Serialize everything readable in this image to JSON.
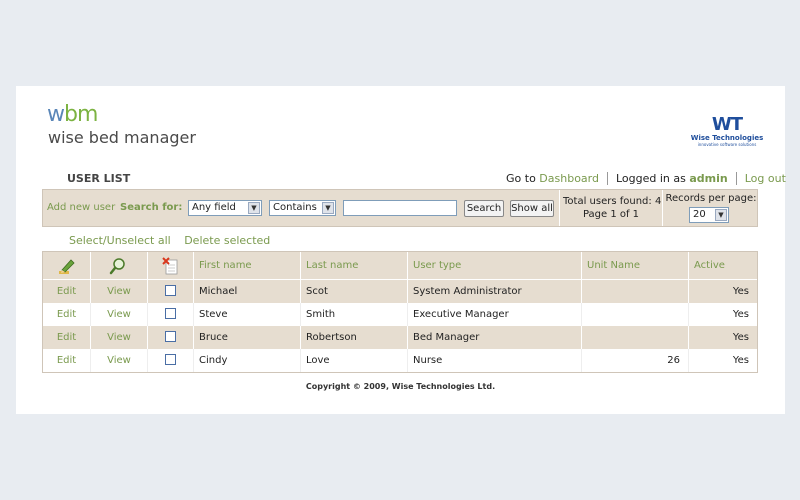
{
  "logo": {
    "mark_w": "w",
    "mark_bm": "bm",
    "name": "wise bed manager"
  },
  "partner": {
    "mark": "WT",
    "name": "Wise Technologies",
    "tagline": "innovative software solutions"
  },
  "title": "USER LIST",
  "topnav": {
    "goto_label": "Go to",
    "dashboard": "Dashboard",
    "logged_prefix": "Logged in as",
    "user": "admin",
    "logout": "Log out"
  },
  "toolbar": {
    "add_new": "Add new user",
    "search_for": "Search for:",
    "field_select": "Any field",
    "mode_select": "Contains",
    "query_value": "",
    "search_button": "Search",
    "show_all_button": "Show all",
    "total_line": "Total users found: 4",
    "page_line": "Page 1 of 1",
    "rpp_label": "Records per page:",
    "rpp_value": "20"
  },
  "actions": {
    "select_toggle": "Select/Unselect all",
    "delete_selected": "Delete selected"
  },
  "table": {
    "headers": [
      "First name",
      "Last name",
      "User type",
      "Unit Name",
      "Active"
    ],
    "edit_label": "Edit",
    "view_label": "View",
    "rows": [
      {
        "first": "Michael",
        "last": "Scot",
        "type": "System Administrator",
        "unit": "",
        "active": "Yes"
      },
      {
        "first": "Steve",
        "last": "Smith",
        "type": "Executive Manager",
        "unit": "",
        "active": "Yes"
      },
      {
        "first": "Bruce",
        "last": "Robertson",
        "type": "Bed Manager",
        "unit": "",
        "active": "Yes"
      },
      {
        "first": "Cindy",
        "last": "Love",
        "type": "Nurse",
        "unit": "26",
        "active": "Yes"
      }
    ]
  },
  "footer": "Copyright © 2009, Wise Technologies Ltd.",
  "colors": {
    "link_green": "#7a9a4e",
    "band_beige": "#e6ddd0",
    "brand_blue": "#1f4e9c"
  }
}
